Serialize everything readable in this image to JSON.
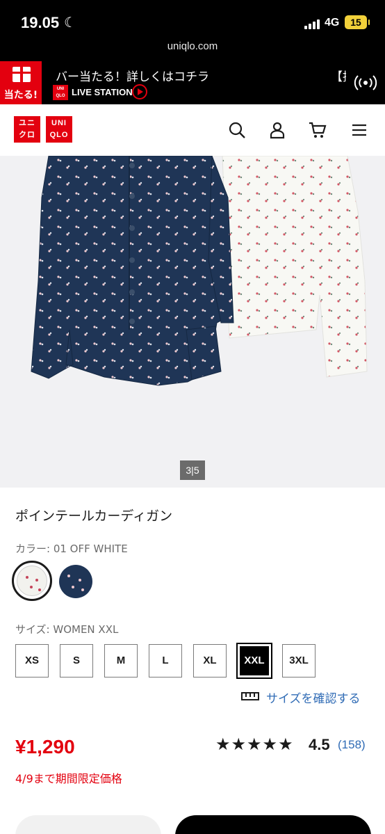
{
  "status": {
    "time": "19.05",
    "network": "4G",
    "battery": "15",
    "url": "uniqlo.com"
  },
  "promo": {
    "badge": "当たる!",
    "headline": "バー当たる！詳しくはコチラ",
    "live_station": "LIVE STATION",
    "mini_logo": "UNIQLO",
    "tail_text": "【抽"
  },
  "header": {
    "logo_top": "ユニクロ",
    "logo_latin": "UNIQLO",
    "icons": [
      "search-icon",
      "user-icon",
      "cart-icon",
      "menu-icon"
    ]
  },
  "gallery": {
    "counter": "3|5"
  },
  "product": {
    "title": "ポインテールカーディガン",
    "color_label": "カラー: 01 OFF WHITE",
    "size_label": "サイズ: WOMEN XXL",
    "sizes": [
      "XS",
      "S",
      "M",
      "L",
      "XL",
      "XXL",
      "3XL"
    ],
    "selected_size": "XXL",
    "size_check": "サイズを確認する",
    "price": "¥1,290",
    "rating": {
      "stars": "★★★★★",
      "score": "4.5",
      "count": "(158)"
    },
    "limited_price": "4/9まで期間限定価格"
  },
  "colors": {
    "brand_red": "#e3000f",
    "link_blue": "#2f6bb5",
    "navy": "#1f3556",
    "off_white": "#f2f2ee"
  }
}
